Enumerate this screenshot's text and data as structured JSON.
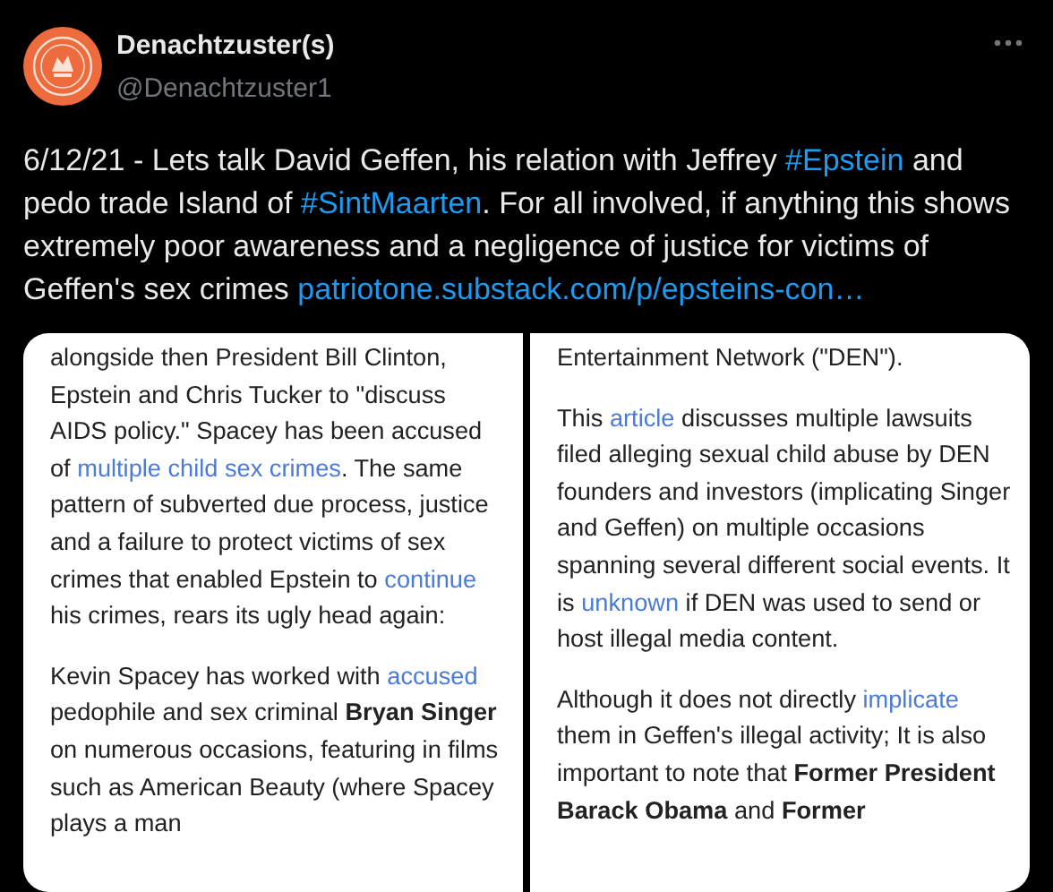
{
  "author": {
    "name": "Denachtzuster(s)",
    "handle": "@Denachtzuster1"
  },
  "text": [
    {
      "kind": "text",
      "text": "6/12/21 - Lets talk David Geffen, his relation with Jeffrey "
    },
    {
      "kind": "link",
      "text": "#Epstein"
    },
    {
      "kind": "text",
      "text": " and pedo trade Island of "
    },
    {
      "kind": "link",
      "text": "#SintMaarten"
    },
    {
      "kind": "text",
      "text": ". For all involved, if anything this shows extremely poor awareness and a negligence of justice for victims of Geffen's sex crimes "
    },
    {
      "kind": "link",
      "text": "patriotone.substack.com/p/epsteins-con…"
    }
  ],
  "media": {
    "columns": [
      {
        "paragraphs": [
          [
            {
              "kind": "text",
              "text": "alongside then President Bill Clinton, Epstein and Chris Tucker to \"discuss AIDS policy.\" Spacey has been accused of "
            },
            {
              "kind": "link",
              "text": "multiple child sex crimes"
            },
            {
              "kind": "text",
              "text": ". The same pattern of subverted due process, justice and a failure to protect victims of sex crimes that enabled Epstein to "
            },
            {
              "kind": "link",
              "text": "continue"
            },
            {
              "kind": "text",
              "text": " his crimes, rears its ugly head again:"
            }
          ],
          [
            {
              "kind": "text",
              "text": "Kevin Spacey has worked with "
            },
            {
              "kind": "link",
              "text": "accused"
            },
            {
              "kind": "text",
              "text": " pedophile and sex criminal "
            },
            {
              "kind": "bold",
              "text": "Bryan Singer"
            },
            {
              "kind": "text",
              "text": " on numerous occasions, featuring in films such as American Beauty (where Spacey plays a man"
            }
          ]
        ]
      },
      {
        "paragraphs": [
          [
            {
              "kind": "text",
              "text": "Entertainment Network (\"DEN\")."
            }
          ],
          [
            {
              "kind": "text",
              "text": "This "
            },
            {
              "kind": "link",
              "text": "article"
            },
            {
              "kind": "text",
              "text": " discusses multiple lawsuits filed alleging sexual child abuse by DEN founders and investors (implicating Singer and Geffen) on multiple occasions spanning several different social events. It is "
            },
            {
              "kind": "link",
              "text": "unknown"
            },
            {
              "kind": "text",
              "text": " if DEN was used to send or host illegal media content."
            }
          ],
          [
            {
              "kind": "text",
              "text": "Although it does not directly "
            },
            {
              "kind": "link",
              "text": "implicate"
            },
            {
              "kind": "text",
              "text": " them in Geffen's illegal activity; It is also important to note that "
            },
            {
              "kind": "bold",
              "text": "Former President Barack Obama"
            },
            {
              "kind": "text",
              "text": " and "
            },
            {
              "kind": "bold",
              "text": "Former"
            }
          ]
        ]
      }
    ]
  }
}
